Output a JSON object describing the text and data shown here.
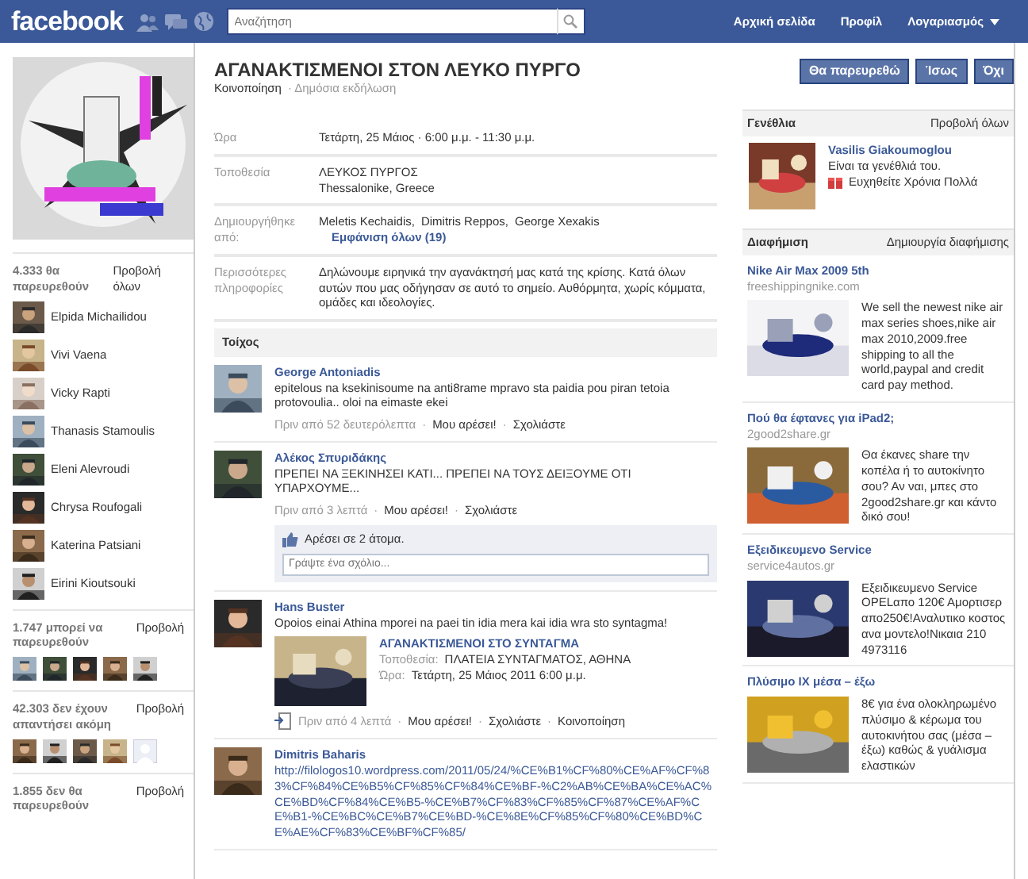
{
  "header": {
    "logo": "facebook",
    "search": {
      "placeholder": "Αναζήτηση"
    },
    "nav": [
      "Αρχική σελίδα",
      "Προφίλ",
      "Λογαριασμός"
    ]
  },
  "left": {
    "groups": [
      {
        "count": "4.333 θα παρευρεθούν",
        "link": "Προβολή όλων",
        "people": [
          "Elpida Michailidou",
          "Vivi Vaena",
          "Vicky Rapti",
          "Thanasis Stamoulis",
          "Eleni Alevroudi",
          "Chrysa Roufogali",
          "Katerina Patsiani",
          "Eirini Kioutsouki"
        ]
      },
      {
        "count": "1.747 μπορεί να παρευρεθούν",
        "link": "Προβολή",
        "thumbnails": [
          {
            "kind": "picture"
          },
          {
            "kind": "picture"
          },
          {
            "kind": "picture"
          },
          {
            "kind": "picture"
          },
          {
            "kind": "picture"
          }
        ]
      },
      {
        "count": "42.303 δεν έχουν απαντήσει ακόμη",
        "link": "Προβολή",
        "thumbnails": [
          {
            "kind": "picture"
          },
          {
            "kind": "picture"
          },
          {
            "kind": "picture"
          },
          {
            "kind": "picture"
          },
          {
            "kind": "silhouette"
          }
        ]
      },
      {
        "count": "1.855 δεν θα παρευρεθούν",
        "link": "Προβολή"
      }
    ]
  },
  "event": {
    "title": "ΑΓΑΝΑΚΤΙΣΜΕΝΟΙ ΣΤΟΝ ΛΕΥΚΟ ΠΥΡΓΟ",
    "share": "Κοινοποίηση",
    "privacy": "· Δημόσια εκδήλωση",
    "details": [
      {
        "label": "Ώρα",
        "kind": "text",
        "lines": [
          "Τετάρτη, 25 Μάιος · 6:00 μ.μ. - 11:30 μ.μ."
        ]
      },
      {
        "label": "Τοποθεσία",
        "kind": "text",
        "lines": [
          "ΛΕΥΚΟΣ ΠΥΡΓΟΣ",
          "Thessalonike, Greece"
        ]
      },
      {
        "label": "Δημιουργήθηκε από:",
        "kind": "links",
        "links": [
          "Meletis Kechaidis",
          "Dimitris Reppos",
          "George Xexakis"
        ],
        "separator": ",",
        "more": "Εμφάνιση όλων (19)"
      },
      {
        "label": "Περισσότερες πληροφορίες",
        "kind": "text",
        "lines": [
          "Δηλώνουμε ειρηνικά την αγανάκτησή μας κατά της κρίσης. Κατά όλων αυτών που μας οδήγησαν σε αυτό το σημείο. Αυθόρμητα, χωρίς κόμματα, ομάδες και ιδεολογίες."
        ]
      }
    ]
  },
  "wall": {
    "title": "Τοίχος",
    "separator": "·",
    "posts": [
      {
        "kind": "status",
        "author": "George Antoniadis",
        "text": "epitelous na ksekinisoume na anti8rame mpravo sta paidia pou piran tetoia protovoulia.. oloi na eimaste ekei",
        "time": "Πριν από 52 δευτερόλεπτα",
        "actions": [
          "Μου αρέσει!",
          "Σχολιάστε"
        ]
      },
      {
        "kind": "status",
        "author": "Αλέκος Σπυριδάκης",
        "text": "ΠΡΕΠΕΙ ΝΑ ΞΕΚΙΝΗΣΕΙ ΚΑΤΙ... ΠΡΕΠΕΙ ΝΑ ΤΟΥΣ ΔΕΙΞΟΥΜΕ ΟΤΙ ΥΠΑΡΧΟΥΜΕ...",
        "time": "Πριν από 3 λεπτά",
        "actions": [
          "Μου αρέσει!",
          "Σχολιάστε"
        ],
        "likes": {
          "prefix": "Αρέσει σε",
          "link": "2 άτομα",
          "suffix": "."
        },
        "comment_placeholder": "Γράψτε ένα σχόλιο..."
      },
      {
        "kind": "event_share",
        "author": "Hans Buster",
        "text": "Opoios einai Athina mporei na paei tin idia mera kai idia wra sto syntagma!",
        "shared": {
          "title": "ΑΓΑΝΑΚΤΙΣΜΕΝΟΙ ΣΤΟ ΣΥΝΤΑΓΜΑ",
          "fields": [
            {
              "label": "Τοποθεσία:",
              "value": "ΠΛΑΤΕΙΑ ΣΥΝΤΑΓΜΑΤΟΣ, ΑΘΗΝΑ"
            },
            {
              "label": "Ώρα:",
              "value": "Τετάρτη, 25 Μάιος 2011 6:00 μ.μ."
            }
          ]
        },
        "time": "Πριν από 4 λεπτά",
        "actions": [
          "Μου αρέσει!",
          "Σχολιάστε",
          "Κοινοποίηση"
        ]
      },
      {
        "kind": "link",
        "author": "Dimitris Baharis",
        "text": "http://filologos10.wordpress.com/2011/05/24/%CE%B1%CF%80%CE%AF%CF%83%CF%84%CE%B5%CF%85%CF%84%CE%BF-%C2%AB%CE%BA%CE%AC%CE%BD%CF%84%CE%B5-%CE%B7%CF%83%CF%85%CF%87%CE%AF%CE%B1-%CE%BC%CE%B7%CE%BD-%CE%8E%CF%85%CF%80%CE%BD%CE%AE%CF%83%CE%BF%CF%85/"
      }
    ]
  },
  "right": {
    "rsvp": [
      "Θα παρευρεθώ",
      "Ίσως",
      "Όχι"
    ],
    "birthdays": {
      "title": "Γενέθλια",
      "link": "Προβολή όλων",
      "name": "Vasilis Giakoumoglou",
      "text": "Είναι τα γενέθλιά του.",
      "action": "Ευχηθείτε Χρόνια Πολλά"
    },
    "ads": {
      "title": "Διαφήμιση",
      "link": "Δημιουργία διαφήμισης",
      "items": [
        {
          "title": "Nike Air Max 2009 5th",
          "domain": "freeshippingnike.com",
          "body": "We sell the newest nike air max series shoes,nike air max 2010,2009.free shipping to all the world,paypal and credit card pay method."
        },
        {
          "title": "Πού θα έφτανες για iPad2;",
          "domain": "2good2share.gr",
          "body": "Θα έκανες share την κοπέλα ή το αυτοκίνητο σου? Αν ναι, μπες στο 2good2share.gr και κάντο δικό σου!"
        },
        {
          "title": "Εξειδικευμενο Service",
          "domain": "service4autos.gr",
          "body": "Εξειδικευμενο Service OPELαπο 120€ Αμορτισερ απο250€!Αναλυτικο κοστος ανα μοντελο!Νικαια 210 4973116"
        },
        {
          "title": "Πλύσιμο ΙΧ μέσα – έξω",
          "body": "8€ για ένα ολοκληρωμένο πλύσιμο & κέρωμα του αυτοκινήτου σας (μέσα – έξω) καθώς & γυάλισμα ελαστικών"
        }
      ]
    }
  }
}
